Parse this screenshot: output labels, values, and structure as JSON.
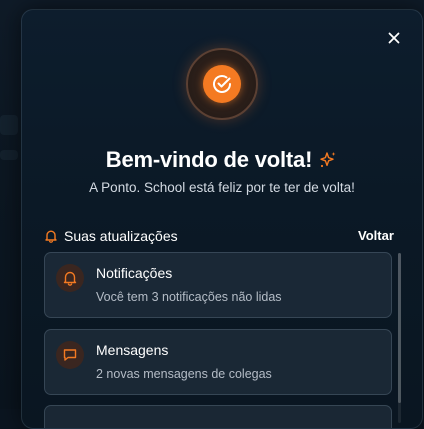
{
  "modal": {
    "title": "Bem-vindo de volta!",
    "subtitle": "A Ponto. School está feliz por te ter de volta!",
    "close_icon": "close-icon",
    "logo_icon": "check-circle-icon",
    "sparkle_icon": "sparkles-icon"
  },
  "updates": {
    "heading": "Suas atualizações",
    "heading_icon": "bell-icon",
    "back_label": "Voltar",
    "items": [
      {
        "icon": "bell-icon",
        "title": "Notificações",
        "description": "Você tem 3 notificações não lidas"
      },
      {
        "icon": "message-icon",
        "title": "Mensagens",
        "description": "2 novas mensagens de colegas"
      }
    ]
  },
  "colors": {
    "accent": "#f47a22",
    "background": "#0b1926",
    "card": "#1f2c3a"
  }
}
